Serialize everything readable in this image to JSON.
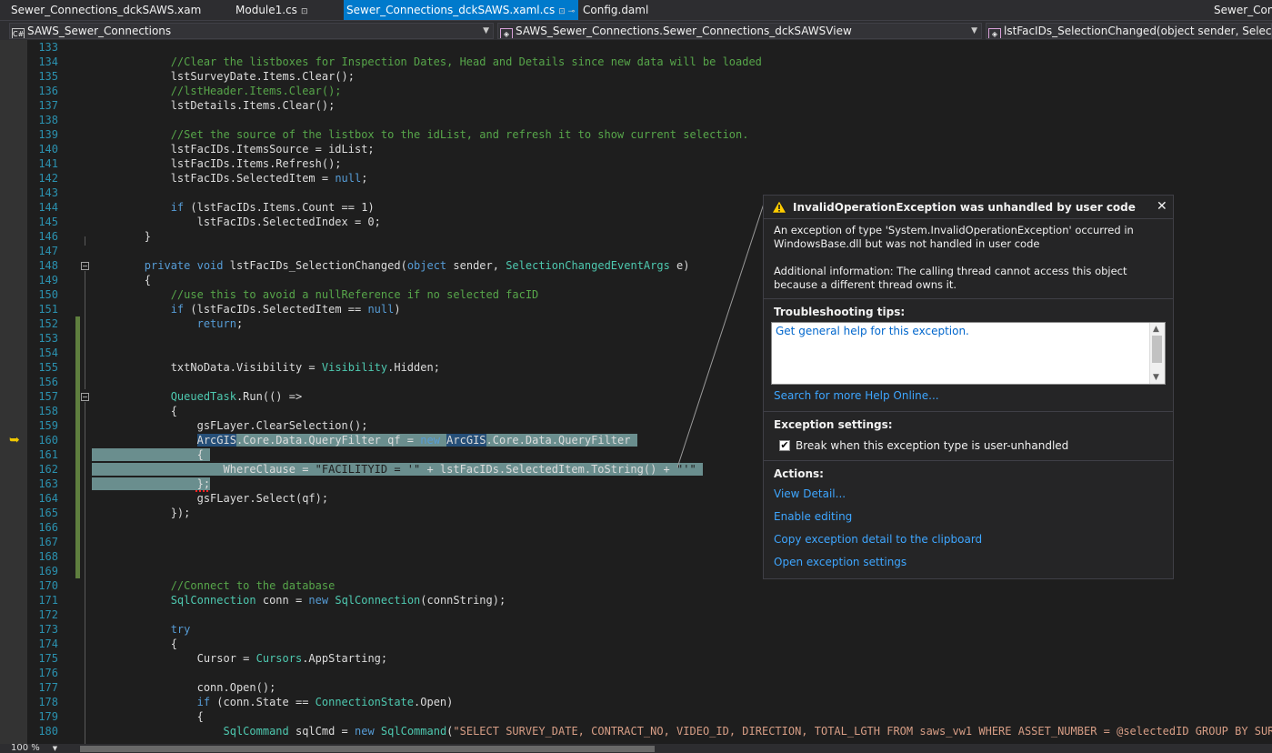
{
  "tabs": [
    {
      "label": "Sewer_Connections_dckSAWS.xaml",
      "pin": "⊡"
    },
    {
      "label": "Module1.cs",
      "pin": "⊡"
    },
    {
      "label": "Sewer_Connections_dckSAWS.xaml.cs",
      "pin": "⊡ ⊸",
      "close": "✕"
    },
    {
      "label": "Config.daml"
    },
    {
      "label": "Sewer_Conn"
    }
  ],
  "navbar": {
    "project": "SAWS_Sewer_Connections",
    "project_glyph": "C#",
    "class": "SAWS_Sewer_Connections.Sewer_Connections_dckSAWSView",
    "member": "lstFacIDs_SelectionChanged(object sender, SelectionCha"
  },
  "line_numbers": [
    "133",
    "134",
    "135",
    "136",
    "137",
    "138",
    "139",
    "140",
    "141",
    "142",
    "143",
    "144",
    "145",
    "146",
    "147",
    "148",
    "149",
    "150",
    "151",
    "152",
    "153",
    "154",
    "155",
    "156",
    "157",
    "158",
    "159",
    "160",
    "161",
    "162",
    "163",
    "164",
    "165",
    "166",
    "167",
    "168",
    "169",
    "170",
    "171",
    "172",
    "173",
    "174",
    "175",
    "176",
    "177",
    "178",
    "179",
    "180"
  ],
  "code": {
    "l134": "            //Clear the listboxes for Inspection Dates, Head and Details since new data will be loaded",
    "l135": "            lstSurveyDate.Items.Clear();",
    "l136": "            //lstHeader.Items.Clear();",
    "l137": "            lstDetails.Items.Clear();",
    "l139": "            //Set the source of the listbox to the idList, and refresh it to show current selection.",
    "l140": "            lstFacIDs.ItemsSource = idList;",
    "l141": "            lstFacIDs.Items.Refresh();",
    "l142a": "            lstFacIDs.SelectedItem = ",
    "null": "null",
    "semi": ";",
    "if": "if",
    "l144a": "            ",
    "l144b": " (lstFacIDs.Items.Count == 1)",
    "l145": "                lstFacIDs.SelectedIndex = 0;",
    "l146": "        }",
    "l148a": "        ",
    "private": "private",
    "void": "void",
    "l148b": " lstFacIDs_SelectionChanged(",
    "object": "object",
    "l148c": " sender, ",
    "scea": "SelectionChangedEventArgs",
    "l148d": " e)",
    "l149": "        {",
    "l150": "            //use this to avoid a nullReference if no selected facID",
    "l151b": " (lstFacIDs.SelectedItem == ",
    "l151c": ")",
    "l152a": "                ",
    "return": "return",
    "l155a": "            txtNoData.Visibility = ",
    "visibility": "Visibility",
    "l155b": ".Hidden;",
    "queuedtask": "QueuedTask",
    "l157b": ".Run(() =>",
    "l158": "            {",
    "l159": "                gsFLayer.ClearSelection();",
    "l160a": "                ",
    "arcgis": "ArcGIS",
    "l160b": ".Core.Data.QueryFilter qf = ",
    "new": "new",
    "l160c": " ",
    "l160d": ".Core.Data.QueryFilter ",
    "l161": "                {",
    "l162a": "                    WhereClause = ",
    "l162s1": "\"FACILITYID = '\"",
    "l162b": " + lstFacIDs.SelectedItem.ToString() + ",
    "l162s2": "\"'\"",
    "l162c": " ",
    "l163": "                };",
    "l164": "                gsFLayer.Select(qf);",
    "l165": "            });",
    "l170": "            //Connect to the database",
    "sqlconnection": "SqlConnection",
    "l171b": " conn = ",
    "l171c": "(connString);",
    "try": "try",
    "l174": "            {",
    "l175a": "                Cursor = ",
    "cursors": "Cursors",
    "l175b": ".AppStarting;",
    "l177": "                conn.Open();",
    "l178b": " (conn.State == ",
    "connectionstate": "ConnectionState",
    "l178c": ".Open)",
    "l179": "                {",
    "sqlcommand": "SqlCommand",
    "l180b": " sqlCmd = ",
    "l180s": "\"SELECT SURVEY_DATE, CONTRACT_NO, VIDEO_ID, DIRECTION, TOTAL_LGTH FROM saws_vw1 WHERE ASSET_NUMBER = @selectedID GROUP BY SURVEY_DA",
    "indent12": "            ",
    "indent16": "                ",
    "indent20": "                    ",
    "open_paren": "(",
    "space": " "
  },
  "exception": {
    "title": "InvalidOperationException was unhandled by user code",
    "close": "✕",
    "message": "An exception of type 'System.InvalidOperationException' occurred in WindowsBase.dll but was not handled in user code",
    "additional": "Additional information: The calling thread cannot access this object because a different thread owns it.",
    "tips_heading": "Troubleshooting tips:",
    "tip_link": "Get general help for this exception.",
    "search_link": "Search for more Help Online...",
    "settings_heading": "Exception settings:",
    "checkbox_label": "Break when this exception type is user-unhandled",
    "checkbox_checked": true,
    "actions_heading": "Actions:",
    "actions": [
      "View Detail...",
      "Enable editing",
      "Copy exception detail to the clipboard",
      "Open exception settings"
    ]
  },
  "status": {
    "zoom": "100 %"
  },
  "colors": {
    "accent": "#007acc",
    "keyword": "#569cd6",
    "comment": "#57a64a",
    "type": "#4ec9b0",
    "string": "#d69d85",
    "line_number": "#2b91af",
    "link": "#3ea6ff"
  }
}
